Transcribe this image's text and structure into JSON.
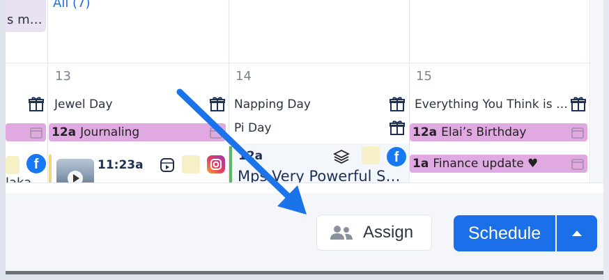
{
  "calendar": {
    "top_partial": {
      "left_text": "s m…",
      "all_label": "All (7)"
    },
    "days": [
      {
        "number": "13",
        "holiday": "Jewel Day",
        "event": {
          "time": "12a",
          "title": "Journaling"
        },
        "post": {
          "time": "11:23a"
        }
      },
      {
        "number": "14",
        "holiday": "Napping Day",
        "holiday2": "Pi Day",
        "post": {
          "time": "12a",
          "title": "Mps Very Powerful S…"
        }
      },
      {
        "number": "15",
        "holiday": "Everything You Think is …",
        "events": [
          {
            "time": "12a",
            "title": "Elai’s Birthday"
          },
          {
            "time": "1a",
            "title": "Finance update ♥"
          }
        ]
      }
    ],
    "left_partial_text": "laka"
  },
  "actions": {
    "assign_label": "Assign",
    "schedule_label": "Schedule"
  },
  "colors": {
    "accent": "#1b6fe8",
    "event_pill": "#e1a9e2",
    "arrow": "#1a73e8"
  }
}
